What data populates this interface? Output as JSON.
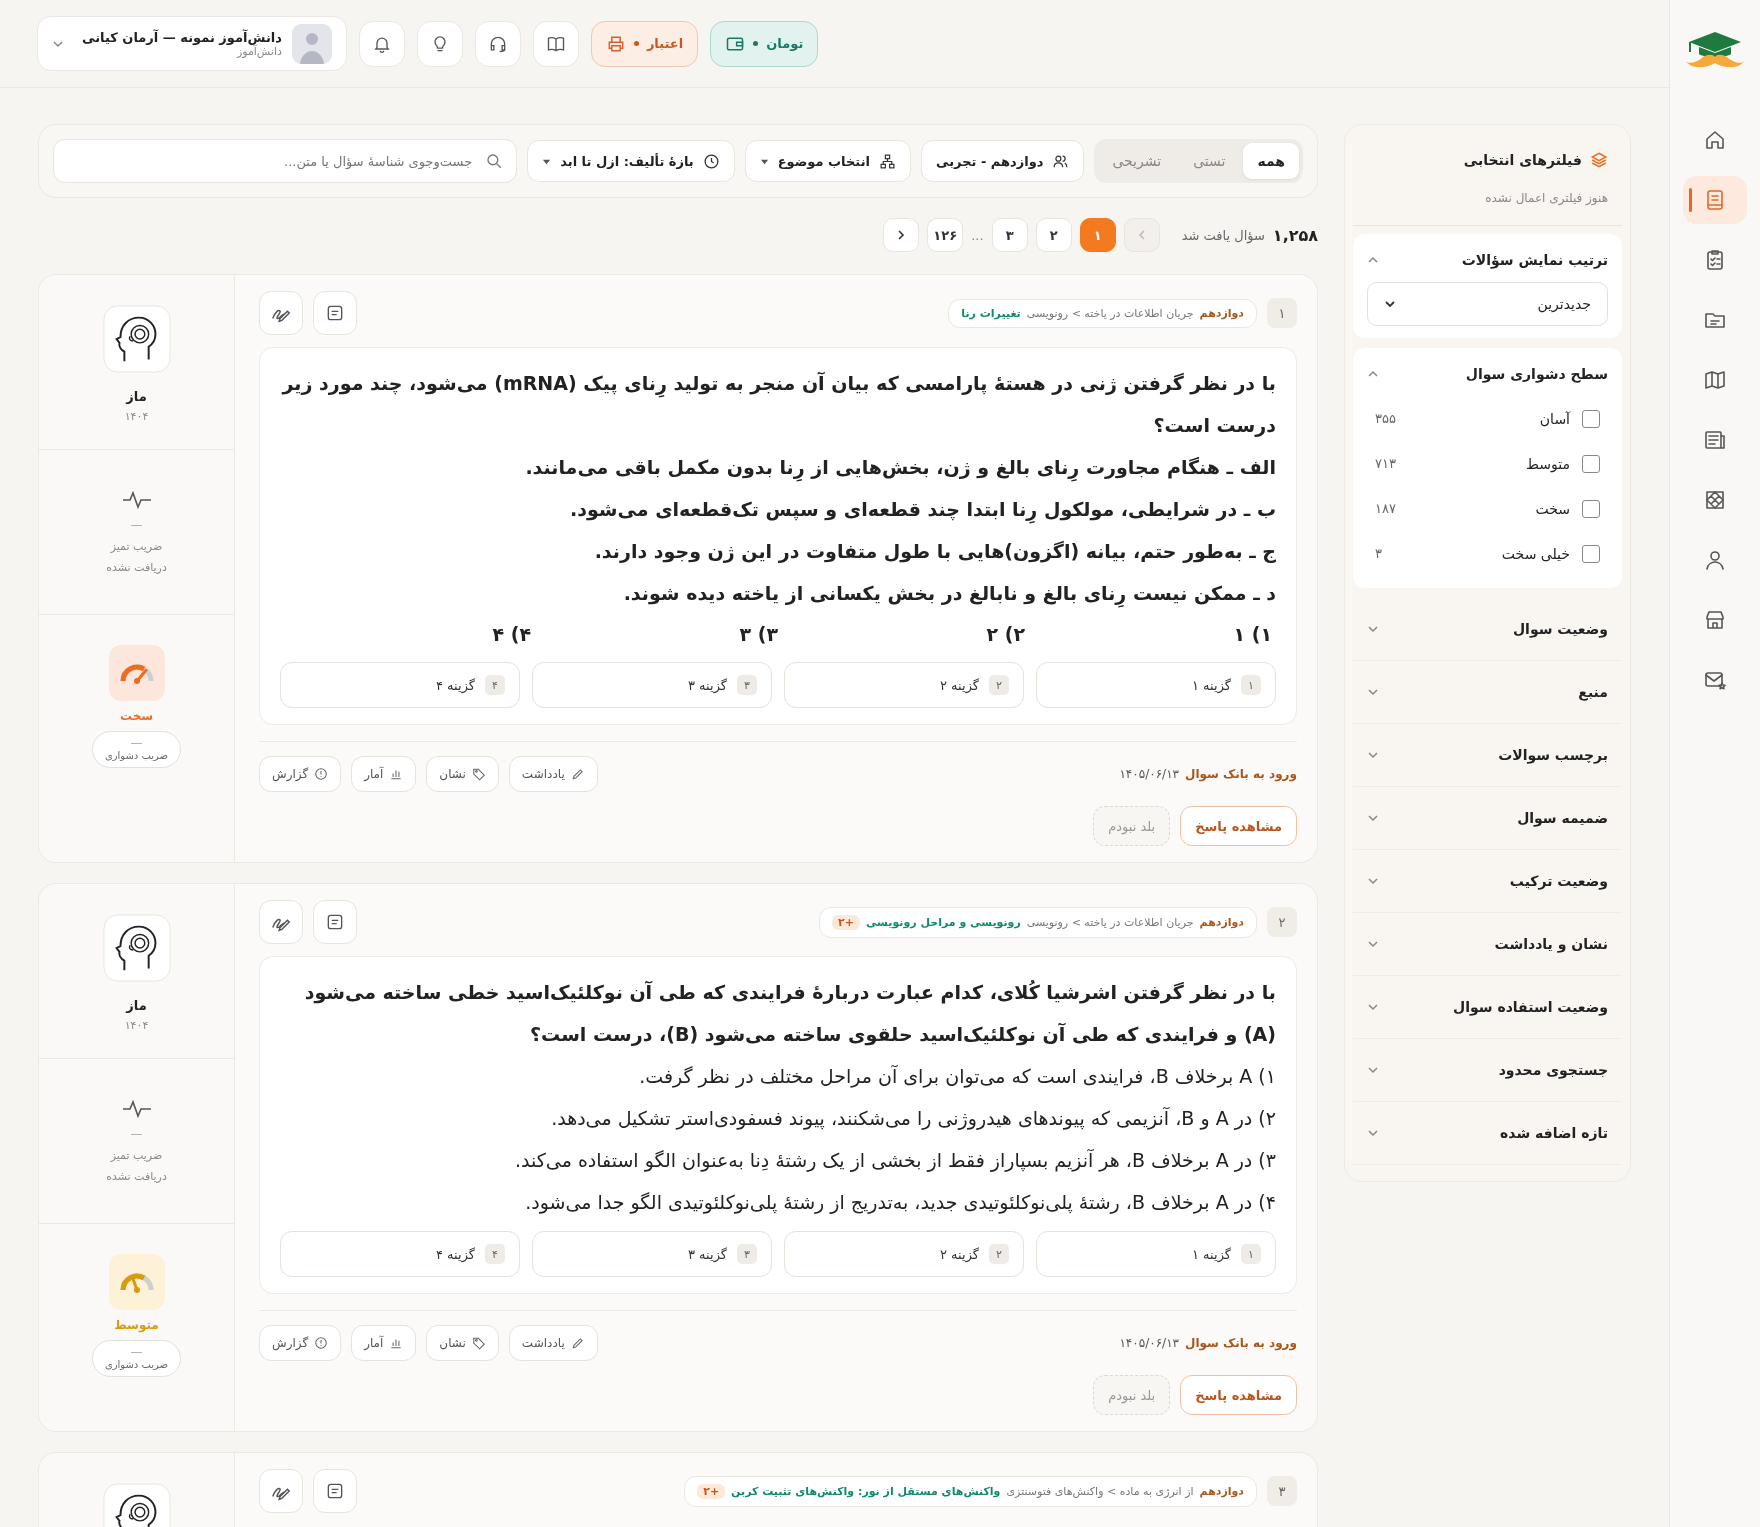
{
  "rail": {
    "items": [
      {
        "selected": false
      },
      {
        "selected": true
      },
      {
        "selected": false
      },
      {
        "selected": false
      },
      {
        "selected": false
      },
      {
        "selected": false
      },
      {
        "selected": false
      },
      {
        "selected": false
      },
      {
        "selected": false
      },
      {
        "selected": false
      }
    ]
  },
  "topbar": {
    "user": {
      "name": "دانش‌آموز نمونه — آرمان کیانی",
      "role": "دانش‌آموز"
    },
    "credit_label": "اعتبار",
    "wallet_label": "تومان"
  },
  "filter_bar": {
    "type_tabs": [
      {
        "label": "همه",
        "selected": true
      },
      {
        "label": "تستی",
        "selected": false
      },
      {
        "label": "تشریحی",
        "selected": false
      }
    ],
    "grade": "دوازدهم - تجربی",
    "topic": "انتخاب موضوع",
    "period": "بازهٔ تألیف: ازل تا ابد",
    "search": {
      "placeholder": "جست‌وجوی شناسهٔ سؤال یا متن..."
    }
  },
  "results": {
    "count": "۱,۲۵۸",
    "label": "سؤال یافت شد",
    "prev_disabled": true,
    "next_disabled": false,
    "pages": [
      {
        "kind": "page",
        "label": "۱",
        "selected": true
      },
      {
        "kind": "page",
        "label": "۲",
        "selected": false
      },
      {
        "kind": "page",
        "label": "۳",
        "selected": false
      },
      {
        "kind": "gap",
        "label": "..."
      },
      {
        "kind": "page",
        "label": "۱۲۶",
        "selected": false
      }
    ]
  },
  "questions": [
    {
      "number": "۱",
      "grade": "دوازدهم",
      "path": "جریان اطلاعات در یاخته > رونویسی",
      "topic": "تغییرات رنا",
      "stem": [
        {
          "kind": "bold",
          "text": "با در نظر گرفتن ژنی در هستهٔ پارامسی که بیان آن منجر به تولید رِنای پیک (mRNA) می‌شود، چند مورد زیر درست است؟"
        },
        {
          "kind": "bold",
          "text": "الف ـ هنگام مجاورت رِنای بالغ و ژن، بخش‌هایی از رِنا بدون مکمل باقی می‌مانند."
        },
        {
          "kind": "bold",
          "text": "ب ـ در شرایطی، مولکول رِنا ابتدا چند قطعه‌ای و سپس تک‌قطعه‌ای می‌شود."
        },
        {
          "kind": "bold",
          "text": "ج ـ به‌طور حتم، بیانه (اگزون)هایی با طول متفاوت در این ژن وجود دارند."
        },
        {
          "kind": "bold",
          "text": "د ـ ممکن نیست رِنای بالغ و نابالغ در بخش یکسانی از یاخته دیده شوند."
        }
      ],
      "answer_row": [
        "۱) ۱",
        "۲) ۲",
        "۳) ۳",
        "۴) ۴"
      ],
      "choices": [
        {
          "num": "۱",
          "label": "گزینه ۱"
        },
        {
          "num": "۲",
          "label": "گزینه ۲"
        },
        {
          "num": "۳",
          "label": "گزینه ۳"
        },
        {
          "num": "۴",
          "label": "گزینه ۴"
        }
      ],
      "actions": [
        "یادداشت",
        "نشان",
        "آمار",
        "گزارش"
      ],
      "entry_label": "ورود به بانک سوال",
      "entry_date": "۱۴۰۵/۰۶/۱۳",
      "answer_button": "مشاهده پاسخ",
      "skip_button": "بلد نبودم",
      "author": "ماز",
      "year": "۱۴۰۴",
      "discrimination": {
        "value": "—",
        "label": "ضریب تمیز",
        "status": "دریافت نشده"
      },
      "difficulty": {
        "kind": "hard",
        "label": "سخت",
        "value": "—",
        "caption": "ضریب دشواری"
      }
    },
    {
      "number": "۲",
      "grade": "دوازدهم",
      "path": "جریان اطلاعات در یاخته > رونویسی",
      "topic": "رونویسی و مراحل رونویسی",
      "extra": "+۲",
      "stem": [
        {
          "kind": "bold",
          "text": "با در نظر گرفتن اشرشیا کُلای، کدام عبارت دربارهٔ فرایندی که طی آن نوکلئیک‌اسید خطی ساخته می‌شود (A) و فرایندی که طی آن نوکلئیک‌اسید حلقوی ساخته می‌شود (B)، درست است؟"
        },
        {
          "kind": "plain",
          "text": "۱) A برخلاف B، فرایندی است که می‌توان برای آن مراحل مختلف در نظر گرفت."
        },
        {
          "kind": "plain",
          "text": "۲) در A و B، آنزیمی که پیوندهای هیدروژنی را می‌شکنند، پیوند فسفودی‌استر تشکیل می‌دهد."
        },
        {
          "kind": "plain",
          "text": "۳) در A برخلاف B، هر آنزیم بسپاراز فقط از بخشی از یک رشتهٔ دِنا به‌عنوان الگو استفاده می‌کند."
        },
        {
          "kind": "plain",
          "text": "۴) در A برخلاف B، رشتهٔ پلی‌نوکلئوتیدی جدید، به‌تدریج از رشتهٔ پلی‌نوکلئوتیدی الگو جدا می‌شود."
        }
      ],
      "choices": [
        {
          "num": "۱",
          "label": "گزینه ۱"
        },
        {
          "num": "۲",
          "label": "گزینه ۲"
        },
        {
          "num": "۳",
          "label": "گزینه ۳"
        },
        {
          "num": "۴",
          "label": "گزینه ۴"
        }
      ],
      "actions": [
        "یادداشت",
        "نشان",
        "آمار",
        "گزارش"
      ],
      "entry_label": "ورود به بانک سوال",
      "entry_date": "۱۴۰۵/۰۶/۱۳",
      "answer_button": "مشاهده پاسخ",
      "skip_button": "بلد نبودم",
      "author": "ماز",
      "year": "۱۴۰۴",
      "discrimination": {
        "value": "—",
        "label": "ضریب تمیز",
        "status": "دریافت نشده"
      },
      "difficulty": {
        "kind": "medium",
        "label": "متوسط",
        "value": "—",
        "caption": "ضریب دشواری"
      }
    },
    {
      "number": "۳",
      "grade": "دوازدهم",
      "path": "از انرژی به ماده > واکنش‌های فتوسنتزی",
      "topic": "واکنش‌های مستقل از نور: واکنش‌های تثبیت کربن",
      "extra": "+۲"
    }
  ],
  "filters": {
    "title": "فیلترهای انتخابی",
    "status": "هنوز فیلتری اعمال نشده",
    "sort": {
      "title": "ترتیب نمایش سؤالات",
      "expanded": true,
      "value": "جدیدترین"
    },
    "difficulty": {
      "title": "سطح دشواری سوال",
      "expanded": true,
      "options": [
        {
          "label": "آسان",
          "count": "۳۵۵",
          "checked": false
        },
        {
          "label": "متوسط",
          "count": "۷۱۳",
          "checked": false
        },
        {
          "label": "سخت",
          "count": "۱۸۷",
          "checked": false
        },
        {
          "label": "خیلی سخت",
          "count": "۳",
          "checked": false
        }
      ]
    },
    "sections": [
      {
        "title": "وضعیت سوال",
        "expanded": false
      },
      {
        "title": "منبع",
        "expanded": false
      },
      {
        "title": "برچسب سوالات",
        "expanded": false
      },
      {
        "title": "ضمیمه سوال",
        "expanded": false
      },
      {
        "title": "وضعیت ترکیب",
        "expanded": false
      },
      {
        "title": "نشان و یادداشت",
        "expanded": false
      },
      {
        "title": "وضعیت استفاده سوال",
        "expanded": false
      },
      {
        "title": "جستجوی محدود",
        "expanded": false
      },
      {
        "title": "تازه اضافه شده",
        "expanded": false
      }
    ]
  }
}
